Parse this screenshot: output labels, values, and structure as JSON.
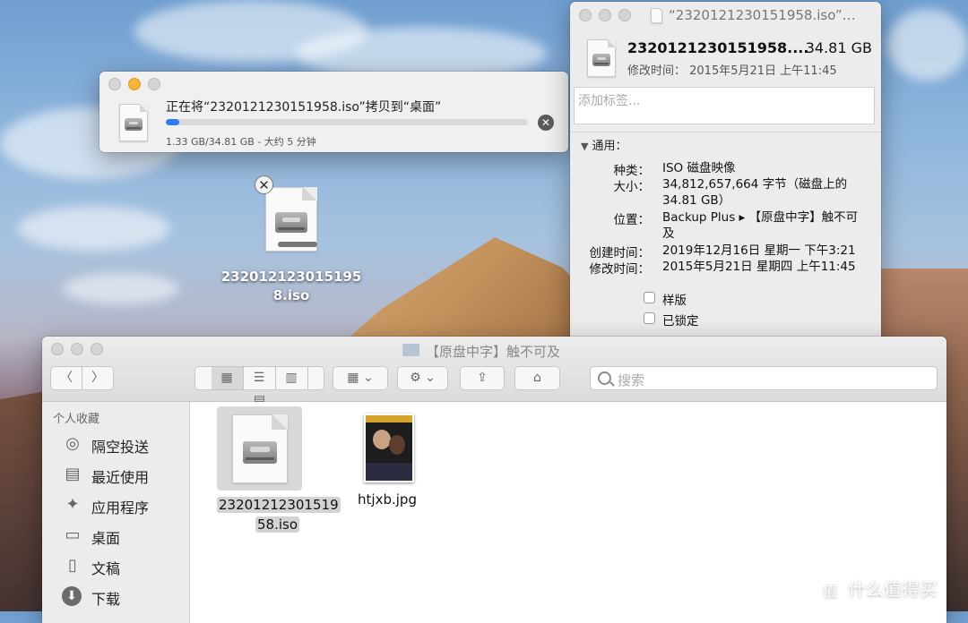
{
  "copy_dialog": {
    "title": "正在将“2320121230151958.iso”拷贝到“桌面”",
    "status": "1.33 GB/34.81 GB - 大约 5 分钟",
    "progress_fraction": 0.0382,
    "cancel_glyph": "✕"
  },
  "desktop_file": {
    "name": "2320121230151958.iso",
    "close_glyph": "✕"
  },
  "info_window": {
    "window_title": "“2320121230151958.iso”…",
    "file_name": "2320121230151958....",
    "file_size": "34.81 GB",
    "modified_line": "修改时间：  2015年5月21日 上午11:45",
    "tags_placeholder": "添加标签...",
    "general_label": "通用：",
    "rows": [
      {
        "key": "种类：",
        "value": "ISO 磁盘映像"
      },
      {
        "key": "大小：",
        "value": "34,812,657,664 字节（磁盘上的 34.81 GB）"
      },
      {
        "key": "位置：",
        "value": "Backup Plus ▸ 【原盘中字】触不可及"
      },
      {
        "key": "创建时间：",
        "value": "2019年12月16日 星期一 下午3:21"
      },
      {
        "key": "修改时间：",
        "value": "2015年5月21日 星期四 上午11:45"
      }
    ],
    "checkboxes": [
      {
        "label": "样版",
        "checked": false
      },
      {
        "label": "已锁定",
        "checked": false
      }
    ]
  },
  "finder": {
    "title": "【原盘中字】触不可及",
    "search_placeholder": "搜索",
    "sidebar_heading": "个人收藏",
    "sidebar_items": [
      {
        "label": "隔空投送",
        "icon": "airdrop-icon"
      },
      {
        "label": "最近使用",
        "icon": "recents-icon"
      },
      {
        "label": "应用程序",
        "icon": "applications-icon"
      },
      {
        "label": "桌面",
        "icon": "desktop-icon"
      },
      {
        "label": "文稿",
        "icon": "documents-icon"
      },
      {
        "label": "下载",
        "icon": "downloads-icon"
      }
    ],
    "files": [
      {
        "name": "2320121230151958.iso",
        "name_line1": "23201212301519",
        "name_line2": "58.iso",
        "selected": true
      },
      {
        "name": "htjxb.jpg",
        "selected": false
      }
    ]
  },
  "watermark": {
    "text": "什么值得买",
    "logo_glyph": "值"
  },
  "colors": {
    "accent": "#2f7bf5",
    "traffic_yellow": "#f5b53b"
  }
}
